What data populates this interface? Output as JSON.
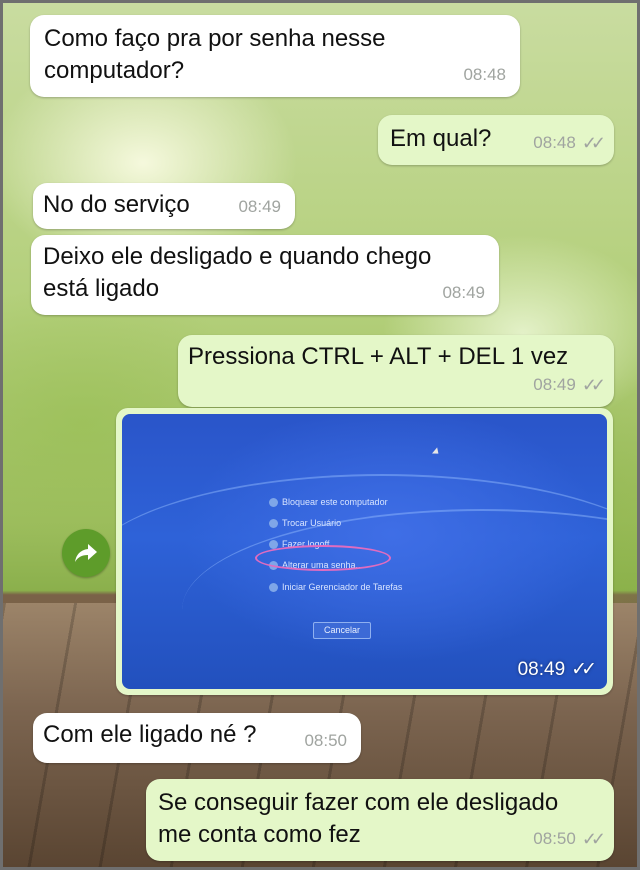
{
  "messages": [
    {
      "text": "Como faço pra por senha nesse\ncomputador?",
      "time": "08:48",
      "direction": "in"
    },
    {
      "text": "Em qual?",
      "time": "08:48",
      "direction": "out"
    },
    {
      "text": "No do serviço",
      "time": "08:49",
      "direction": "in"
    },
    {
      "text": "Deixo ele desligado e quando chego\nestá ligado",
      "time": "08:49",
      "direction": "in"
    },
    {
      "text": "Pressiona CTRL + ALT + DEL 1 vez",
      "time": "08:49",
      "direction": "out"
    },
    {
      "text": "Com ele ligado né ?",
      "time": "08:50",
      "direction": "in"
    },
    {
      "text": "Se conseguir fazer com ele desligado\nme conta como fez",
      "time": "08:50",
      "direction": "out"
    }
  ],
  "photo": {
    "time": "08:49",
    "menu_items": [
      "Bloquear este computador",
      "Trocar Usuário",
      "Fazer logoff",
      "Alterar uma senha...",
      "Iniciar Gerenciador de Tarefas"
    ],
    "cancel_label": "Cancelar"
  },
  "icons": {
    "forward": "forward-arrow-icon",
    "read_receipt": "double-check-icon"
  },
  "colors": {
    "incoming_bubble": "#ffffff",
    "outgoing_bubble": "#e4f7c8",
    "forward_button": "#5e9c2a",
    "highlight_circle": "#e06cc0"
  }
}
